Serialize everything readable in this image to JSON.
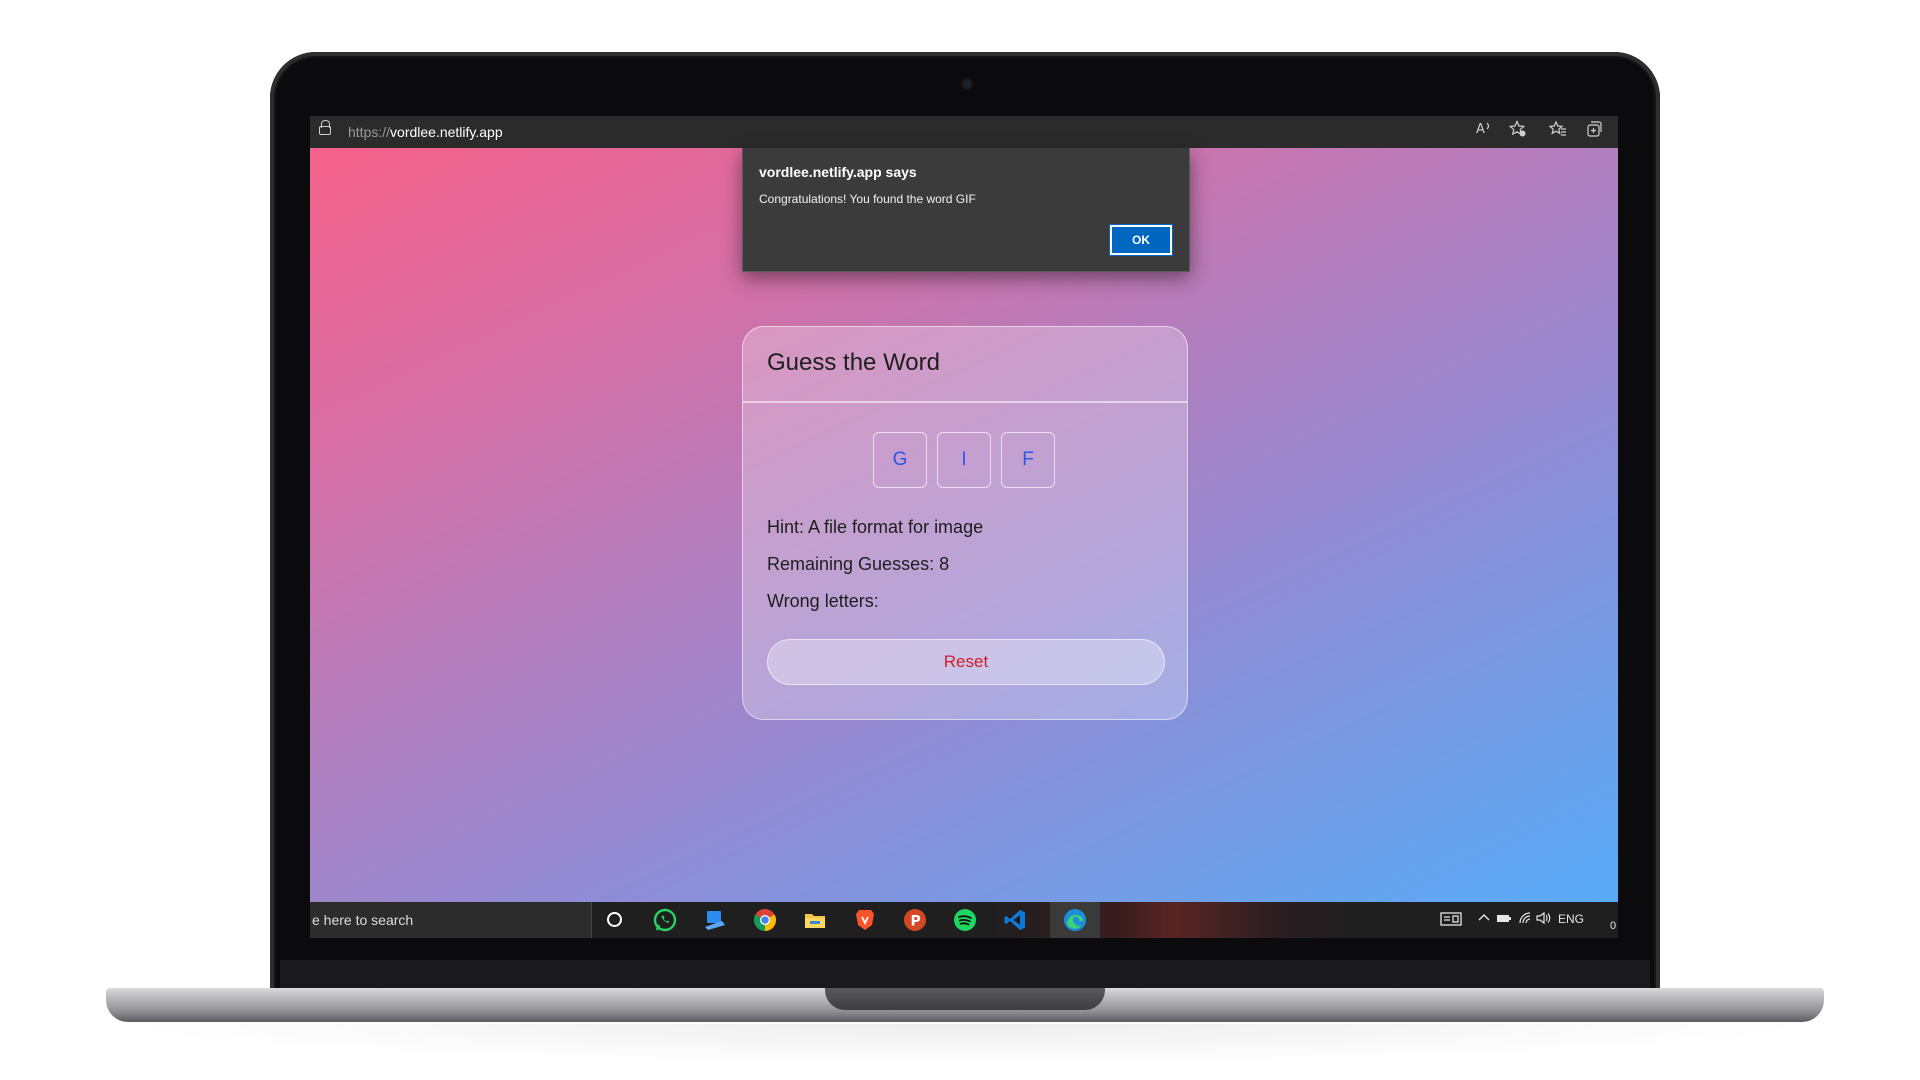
{
  "browser": {
    "url_protocol": "https://",
    "url_host": "vordlee.netlify.app",
    "toolbar_icons": [
      "read-aloud-icon",
      "add-favorite-icon",
      "favorites-icon",
      "collections-icon"
    ]
  },
  "dialog": {
    "title": "vordlee.netlify.app says",
    "message": "Congratulations! You found the word GIF",
    "ok_label": "OK"
  },
  "game": {
    "title": "Guess the Word",
    "letters": [
      "G",
      "I",
      "F"
    ],
    "hint": "Hint: A file format for image",
    "remaining": "Remaining Guesses: 8",
    "wrong": "Wrong letters:",
    "reset_label": "Reset"
  },
  "taskbar": {
    "search_placeholder": "e here to search",
    "apps": [
      "cortana-icon",
      "whatsapp-icon",
      "app-icon",
      "chrome-icon",
      "file-explorer-icon",
      "brave-icon",
      "powerpoint-icon",
      "spotify-icon",
      "vscode-icon",
      "edge-icon"
    ],
    "tray_lang": "ENG",
    "tray_extra": "0"
  }
}
